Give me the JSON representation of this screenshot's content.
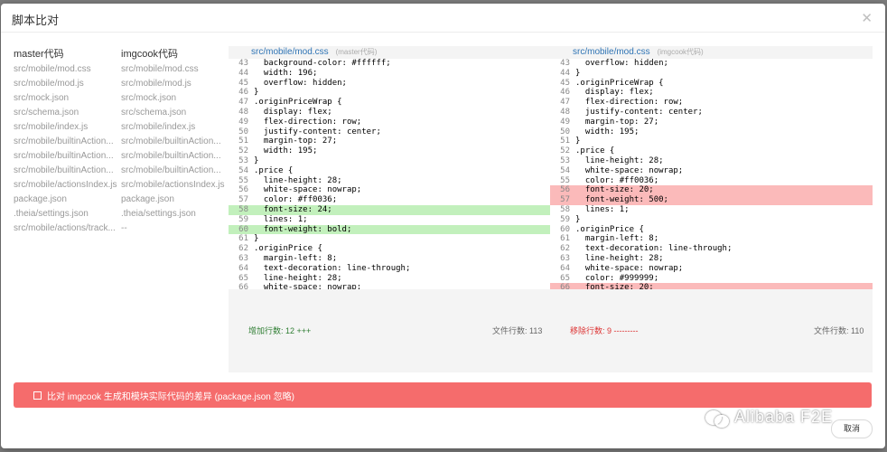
{
  "modal": {
    "title": "脚本比对"
  },
  "lists": {
    "master_header": "master代码",
    "imgcook_header": "imgcook代码",
    "master": [
      "src/mobile/mod.css",
      "src/mobile/mod.js",
      "src/mock.json",
      "src/schema.json",
      "src/mobile/index.js",
      "src/mobile/builtinAction...",
      "src/mobile/builtinAction...",
      "src/mobile/builtinAction...",
      "src/mobile/actionsIndex.js",
      "package.json",
      ".theia/settings.json",
      "src/mobile/actions/track..."
    ],
    "imgcook": [
      "src/mobile/mod.css",
      "src/mobile/mod.js",
      "src/mock.json",
      "src/schema.json",
      "src/mobile/index.js",
      "src/mobile/builtinAction...",
      "src/mobile/builtinAction...",
      "src/mobile/builtinAction...",
      "src/mobile/actionsIndex.js",
      "package.json",
      ".theia/settings.json",
      "--"
    ]
  },
  "left_diff": {
    "file": "src/mobile/mod.css",
    "tag": "(master代码)",
    "lines": [
      {
        "n": "43",
        "t": "  background-color: #ffffff;",
        "s": ""
      },
      {
        "n": "44",
        "t": "  width: 196;",
        "s": ""
      },
      {
        "n": "45",
        "t": "  overflow: hidden;",
        "s": ""
      },
      {
        "n": "46",
        "t": "}",
        "s": ""
      },
      {
        "n": "47",
        "t": ".originPriceWrap {",
        "s": ""
      },
      {
        "n": "48",
        "t": "  display: flex;",
        "s": ""
      },
      {
        "n": "49",
        "t": "  flex-direction: row;",
        "s": ""
      },
      {
        "n": "50",
        "t": "  justify-content: center;",
        "s": ""
      },
      {
        "n": "51",
        "t": "  margin-top: 27;",
        "s": ""
      },
      {
        "n": "52",
        "t": "  width: 195;",
        "s": ""
      },
      {
        "n": "53",
        "t": "}",
        "s": ""
      },
      {
        "n": "54",
        "t": ".price {",
        "s": ""
      },
      {
        "n": "55",
        "t": "  line-height: 28;",
        "s": ""
      },
      {
        "n": "56",
        "t": "  white-space: nowrap;",
        "s": ""
      },
      {
        "n": "57",
        "t": "  color: #ff0036;",
        "s": ""
      },
      {
        "n": "58",
        "t": "  font-size: 24;",
        "s": "add"
      },
      {
        "n": "59",
        "t": "  lines: 1;",
        "s": ""
      },
      {
        "n": "60",
        "t": "  font-weight: bold;",
        "s": "add"
      },
      {
        "n": "61",
        "t": "}",
        "s": ""
      },
      {
        "n": "62",
        "t": ".originPrice {",
        "s": ""
      },
      {
        "n": "63",
        "t": "  margin-left: 8;",
        "s": ""
      },
      {
        "n": "64",
        "t": "  text-decoration: line-through;",
        "s": ""
      },
      {
        "n": "65",
        "t": "  line-height: 28;",
        "s": ""
      },
      {
        "n": "66",
        "t": "  white-space: nowrap;",
        "s": ""
      }
    ]
  },
  "right_diff": {
    "file": "src/mobile/mod.css",
    "tag": "(imgcook代码)",
    "lines": [
      {
        "n": "43",
        "t": "  overflow: hidden;",
        "s": ""
      },
      {
        "n": "44",
        "t": "}",
        "s": ""
      },
      {
        "n": "45",
        "t": ".originPriceWrap {",
        "s": ""
      },
      {
        "n": "46",
        "t": "  display: flex;",
        "s": ""
      },
      {
        "n": "47",
        "t": "  flex-direction: row;",
        "s": ""
      },
      {
        "n": "48",
        "t": "  justify-content: center;",
        "s": ""
      },
      {
        "n": "49",
        "t": "  margin-top: 27;",
        "s": ""
      },
      {
        "n": "50",
        "t": "  width: 195;",
        "s": ""
      },
      {
        "n": "51",
        "t": "}",
        "s": ""
      },
      {
        "n": "52",
        "t": ".price {",
        "s": ""
      },
      {
        "n": "53",
        "t": "  line-height: 28;",
        "s": ""
      },
      {
        "n": "54",
        "t": "  white-space: nowrap;",
        "s": ""
      },
      {
        "n": "55",
        "t": "  color: #ff0036;",
        "s": ""
      },
      {
        "n": "56",
        "t": "  font-size: 20;",
        "s": "del"
      },
      {
        "n": "57",
        "t": "  font-weight: 500;",
        "s": "del"
      },
      {
        "n": "58",
        "t": "  lines: 1;",
        "s": ""
      },
      {
        "n": "59",
        "t": "}",
        "s": ""
      },
      {
        "n": "60",
        "t": ".originPrice {",
        "s": ""
      },
      {
        "n": "61",
        "t": "  margin-left: 8;",
        "s": ""
      },
      {
        "n": "62",
        "t": "  text-decoration: line-through;",
        "s": ""
      },
      {
        "n": "63",
        "t": "  line-height: 28;",
        "s": ""
      },
      {
        "n": "64",
        "t": "  white-space: nowrap;",
        "s": ""
      },
      {
        "n": "65",
        "t": "  color: #999999;",
        "s": ""
      },
      {
        "n": "66",
        "t": "  font-size: 20;",
        "s": "del"
      }
    ]
  },
  "stats": {
    "added": "增加行数: 12  +++",
    "left_count": "文件行数: 113",
    "removed": "移除行数: 9  ---------",
    "right_count": "文件行数: 110"
  },
  "alert": {
    "text": "比对 imgcook 生成和模块实际代码的差异 (package.json 忽略)"
  },
  "watermark": {
    "text": "Alibaba F2E"
  },
  "footer": {
    "cancel_label": "取消"
  }
}
